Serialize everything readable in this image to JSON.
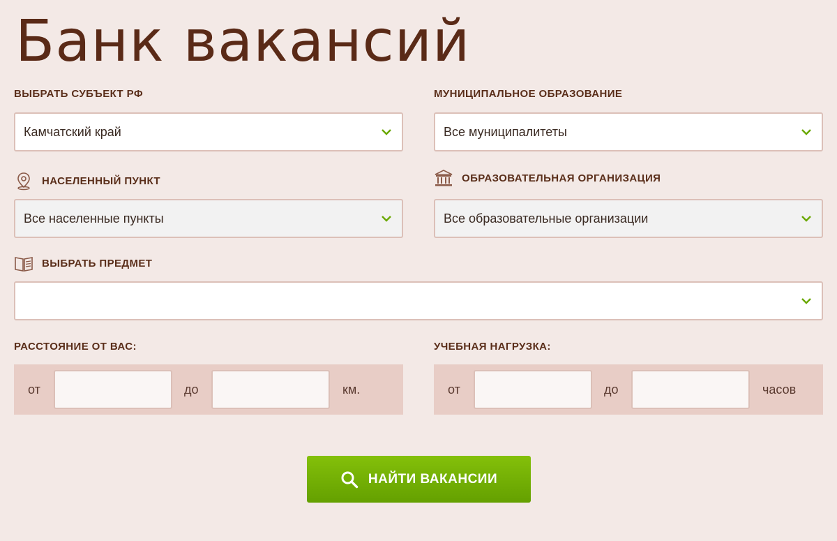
{
  "title": "Банк вакансий",
  "region": {
    "label": "ВЫБРАТЬ СУБЪЕКТ РФ",
    "value": "Камчатский край"
  },
  "municipality": {
    "label": "МУНИЦИПАЛЬНОЕ ОБРАЗОВАНИЕ",
    "value": "Все муниципалитеты"
  },
  "settlement": {
    "label": "НАСЕЛЕННЫЙ ПУНКТ",
    "value": "Все населенные пункты",
    "icon": "location-pin-icon"
  },
  "organization": {
    "label": "ОБРАЗОВАТЕЛЬНАЯ ОРГАНИЗАЦИЯ",
    "value": "Все образовательные организации",
    "icon": "institution-icon"
  },
  "subject": {
    "label": "ВЫБРАТЬ ПРЕДМЕТ",
    "value": "",
    "icon": "book-icon"
  },
  "distance": {
    "label": "РАССТОЯНИЕ ОТ ВАС:",
    "from_label": "от",
    "to_label": "до",
    "unit": "км.",
    "from_value": "",
    "to_value": ""
  },
  "workload": {
    "label": "УЧЕБНАЯ НАГРУЗКА:",
    "from_label": "от",
    "to_label": "до",
    "unit": "часов",
    "from_value": "",
    "to_value": ""
  },
  "search_button": {
    "label": "НАЙТИ ВАКАНСИИ",
    "icon": "search-icon"
  },
  "colors": {
    "background": "#f3e9e6",
    "title": "#5a2a17",
    "accent_green": "#75b000",
    "field_border": "#dcc0b8",
    "range_band": "#e8cdc6"
  }
}
